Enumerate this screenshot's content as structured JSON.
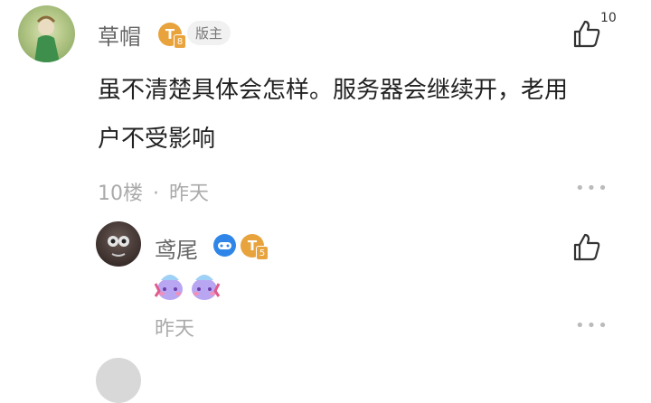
{
  "main_comment": {
    "username": "草帽",
    "level_badge": "T",
    "level_sub": "8",
    "role_badge": "版主",
    "like_count": "10",
    "content_line1": "虽不清楚具体会怎样。服务器会继续开，老用",
    "content_line2": "户不受影响",
    "floor": "10楼",
    "separator": "·",
    "time": "昨天"
  },
  "reply": {
    "username": "鸢尾",
    "level_badge": "T",
    "level_sub": "5",
    "time": "昨天"
  },
  "colors": {
    "badge_gold": "#E8A33D",
    "badge_blue": "#2F86E8",
    "text_main": "#222222",
    "text_meta": "#AAAAAA"
  }
}
